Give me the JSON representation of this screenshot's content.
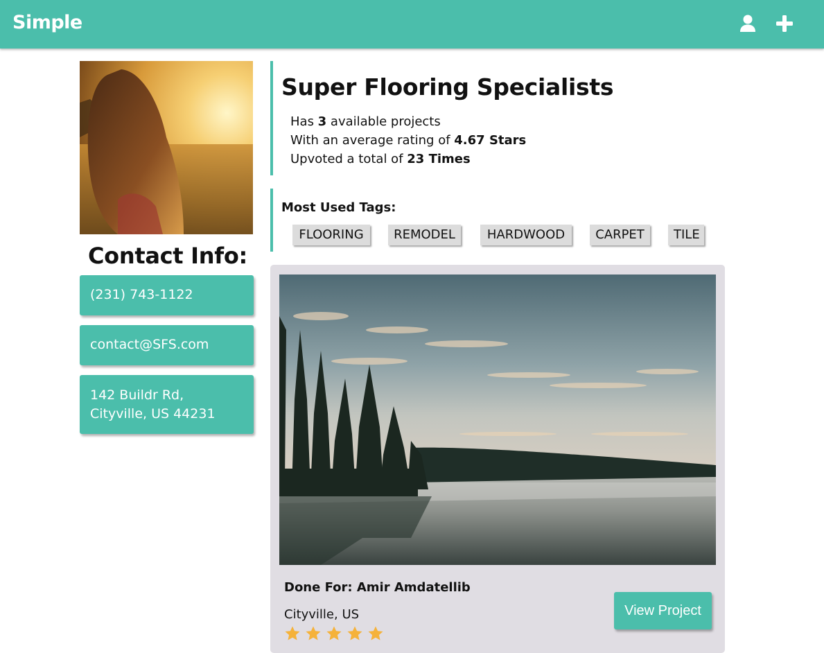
{
  "navbar": {
    "brand": "Simple",
    "icons": [
      "user-icon",
      "plus-icon"
    ]
  },
  "sidebar": {
    "contact_title": "Contact Info:",
    "phone": "(231) 743-1122",
    "email": "contact@SFS.com",
    "address": "142 Buildr Rd, Cityville, US 44231"
  },
  "company": {
    "name": "Super Flooring Specialists",
    "projects_prefix": "Has ",
    "projects_count": "3",
    "projects_suffix": " available projects",
    "rating_prefix": "With an average rating of ",
    "rating_value": "4.67 Stars",
    "upvotes_prefix": "Upvoted a total of ",
    "upvotes_value": "23 Times"
  },
  "tags": {
    "title": "Most Used Tags:",
    "items": [
      "FLOORING",
      "REMODEL",
      "HARDWOOD",
      "CARPET",
      "TILE"
    ]
  },
  "project": {
    "done_for": "Done For: Amir Amdatellib",
    "location": "Cityville, US",
    "rating": 5,
    "rating_max": 5,
    "view_label": "View Project"
  },
  "colors": {
    "accent": "#4bbeab",
    "card_bg": "#e0dde3",
    "tag_bg": "#dcdcdc",
    "star": "#f5b23a"
  }
}
